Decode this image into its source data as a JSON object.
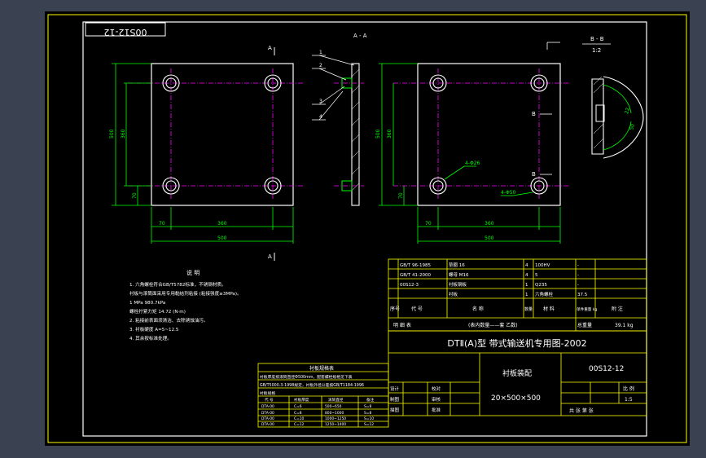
{
  "drawing": {
    "stamp_code": "00S12-12",
    "section_aa_label": "A - A",
    "view_label": "",
    "section_bb_label": "B - B",
    "section_bb_scale": "1:2",
    "view_a_markers": [
      "A",
      "A"
    ],
    "view_b_markers": [
      "B",
      "B"
    ],
    "front_view_dims": {
      "height_total": "500",
      "height_inner": "360",
      "edge_v": "70",
      "edge_h": "70",
      "width_inner": "360",
      "width_total": "500"
    },
    "right_view_dims": {
      "height_total": "500",
      "height_inner": "360",
      "edge_v": "70",
      "edge_h": "70",
      "width_inner": "360",
      "width_total": "500",
      "hole_note_1": "4-Φ26",
      "hole_note_2": "4-Φ50"
    },
    "side_view_leaders": [
      "1",
      "2",
      "3",
      "4"
    ],
    "detail_dims": [
      "22",
      "50"
    ]
  },
  "notes": {
    "title": "说 明",
    "lines": [
      "1. 六角螺栓符合GB/T5782标准，不锈钢材质。",
      "   衬板与滚筒面采用专用黏结剂粘接 (粘接强度≥3MPa)。",
      "   1 MPa 980.7kPa",
      "   螺栓拧紧力矩 14.72 (N·m)",
      "2. 粘接前表面须清洁、去除锈蚀油污。",
      "3. 衬板硬度 A=5~12.5",
      "4. 其余按标准处理。"
    ]
  },
  "parts_table": {
    "rows": [
      {
        "code": "GB/T 96-1985",
        "name": "垫圈 16",
        "qty": "4",
        "material": "100HV",
        "weight": "-"
      },
      {
        "code": "GB/T 41-2000",
        "name": "螺母 M16",
        "qty": "4",
        "material": "5",
        "weight": "-"
      },
      {
        "code": "00S12-3",
        "name": "衬板钢板",
        "qty": "1",
        "material": "Q235",
        "weight": "-"
      },
      {
        "code": "",
        "name": "衬板",
        "qty": "1",
        "material": "六角螺栓",
        "weight": "37.5"
      }
    ],
    "header": [
      "序号",
      "代 号",
      "名 称",
      "数量",
      "材 料",
      "单件重量 kg",
      "附 注"
    ],
    "total_row": {
      "label": "明 细 表",
      "note": "(表内数量——套 乙数)",
      "weight_label": "总重量",
      "weight": "39.1 kg"
    }
  },
  "title_block": {
    "series_title": "DTⅡ(A)型 带式输送机专用图-2002",
    "drawing_name": "衬板装配",
    "drawing_spec": "20×500×500",
    "drawing_code": "00S12-12",
    "scale_label": "比 例",
    "scale": "1:5",
    "sheet_label": "共 张 第 张",
    "roles": [
      "设计",
      "制图",
      "描图",
      "校对",
      "审核",
      "批准"
    ]
  },
  "spec_table": {
    "title": "衬板规格表",
    "lines": [
      "衬板厚度按滚筒直径Φ500mm，配套螺栓规格见下表",
      "GB/T5000.3-1998规定，衬板外径公差按GB/T1184-1996",
      "衬板规格"
    ],
    "header": [
      "代 号",
      "衬板厚度",
      "滚筒直径",
      "备注"
    ],
    "rows": [
      [
        "DTA-00",
        "C=6",
        "500~650",
        "S=8"
      ],
      [
        "DTA-00",
        "C=8",
        "800~1000",
        "S=8"
      ],
      [
        "DTA-00",
        "C=10",
        "1000~1250",
        "S=10"
      ],
      [
        "DTA-00",
        "C=12",
        "1250~1400",
        "S=12"
      ]
    ]
  },
  "colors": {
    "background": "#000000",
    "frame_border": "#ffff00",
    "geometry": "#ffffff",
    "centerline": "#ff00ff",
    "dimension": "#00ff00",
    "table_lines": "#ffff00",
    "table_text": "#ffffff",
    "app_background": "#3a4150"
  }
}
